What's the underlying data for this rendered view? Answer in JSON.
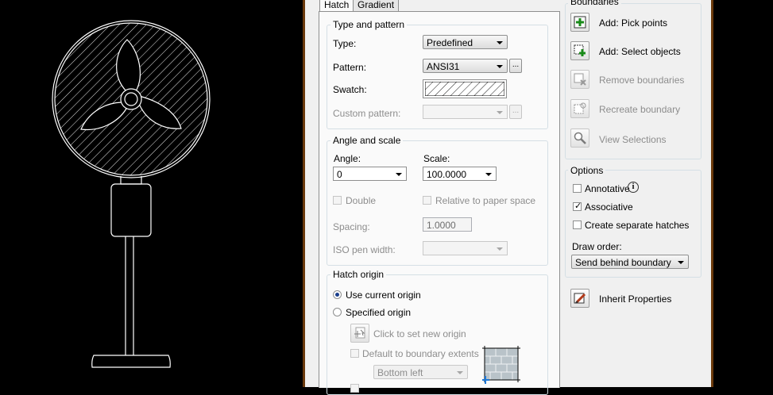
{
  "tabs": {
    "hatch": "Hatch",
    "gradient": "Gradient"
  },
  "type_and_pattern": {
    "title": "Type and pattern",
    "type_label": "Type:",
    "type_value": "Predefined",
    "pattern_label": "Pattern:",
    "pattern_value": "ANSI31",
    "swatch_label": "Swatch:",
    "custom_pattern_label": "Custom pattern:",
    "custom_pattern_value": ""
  },
  "angle_and_scale": {
    "title": "Angle and scale",
    "angle_label": "Angle:",
    "angle_value": "0",
    "scale_label": "Scale:",
    "scale_value": "100.0000",
    "double_label": "Double",
    "relative_label": "Relative to paper space",
    "spacing_label": "Spacing:",
    "spacing_value": "1.0000",
    "iso_label": "ISO pen width:",
    "iso_value": ""
  },
  "hatch_origin": {
    "title": "Hatch origin",
    "use_current_label": "Use current origin",
    "specified_label": "Specified origin",
    "click_set_label": "Click to set new origin",
    "default_extents_label": "Default to boundary extents",
    "position_value": "Bottom left"
  },
  "boundaries": {
    "title": "Boundaries",
    "add_pick_points": "Add: Pick points",
    "add_select_objects": "Add: Select objects",
    "remove_boundaries": "Remove boundaries",
    "recreate_boundary": "Recreate boundary",
    "view_selections": "View Selections"
  },
  "options": {
    "title": "Options",
    "annotative_label": "Annotative",
    "associative_label": "Associative",
    "separate_label": "Create separate hatches",
    "draw_order_label": "Draw order:",
    "draw_order_value": "Send behind boundary",
    "annotative_checked": false,
    "associative_checked": true,
    "separate_checked": false
  },
  "inherit_properties": "Inherit Properties",
  "colors": {
    "canvas": "#000000",
    "dialog": "#f0f0f0",
    "frame": "#6b3a0c"
  }
}
